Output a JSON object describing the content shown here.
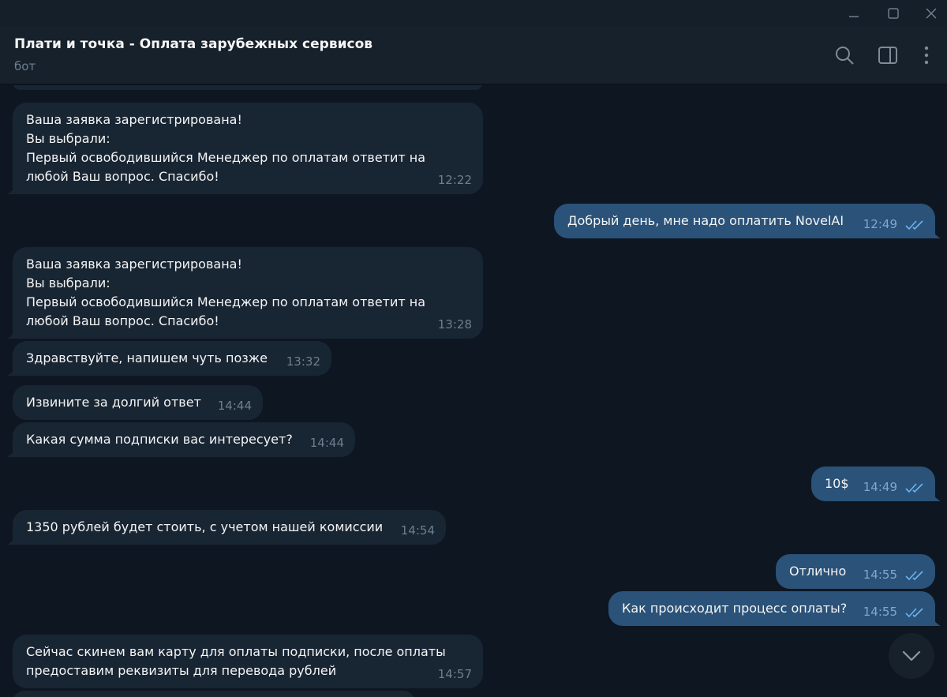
{
  "window": {
    "minimize_icon": "minimize-icon",
    "maximize_icon": "maximize-icon",
    "close_icon": "close-icon"
  },
  "header": {
    "title": "Плати и точка - Оплата зарубежных сервисов",
    "subtitle": "бот",
    "icons": [
      "search-icon",
      "sidebar-toggle-icon",
      "more-vertical-icon"
    ]
  },
  "messages": [
    {
      "dir": "in",
      "lines": [
        "Ваша заявка зарегистрирована!",
        "Вы выбрали:",
        "Первый освободившийся Менеджер по оплатам ответит на",
        "любой Ваш вопрос. Спасибо!"
      ],
      "time": "12:22"
    },
    {
      "dir": "out",
      "lines": [
        "Добрый день, мне надо оплатить NovelAI"
      ],
      "time": "12:49",
      "read": true
    },
    {
      "dir": "in",
      "lines": [
        "Ваша заявка зарегистрирована!",
        "Вы выбрали:",
        "Первый освободившийся Менеджер по оплатам ответит на",
        "любой Ваш вопрос. Спасибо!"
      ],
      "time": "13:28"
    },
    {
      "dir": "in",
      "lines": [
        "Здравствуйте, напишем чуть позже"
      ],
      "time": "13:32"
    },
    {
      "dir": "in",
      "lines": [
        "Извините за долгий ответ"
      ],
      "time": "14:44"
    },
    {
      "dir": "in",
      "lines": [
        "Какая сумма подписки вас интересует?"
      ],
      "time": "14:44"
    },
    {
      "dir": "out",
      "lines": [
        "10$"
      ],
      "time": "14:49",
      "read": true
    },
    {
      "dir": "in",
      "lines": [
        "1350 рублей будет стоить, с учетом нашей комиссии"
      ],
      "time": "14:54"
    },
    {
      "dir": "out",
      "lines": [
        "Отлично"
      ],
      "time": "14:55",
      "read": true
    },
    {
      "dir": "out",
      "lines": [
        "Как происходит процесс оплаты?"
      ],
      "time": "14:55",
      "read": true
    },
    {
      "dir": "in",
      "lines": [
        "Сейчас скинем вам карту для оплаты подписки, после оплаты",
        "предоставим реквизиты для перевода рублей"
      ],
      "time": "14:57"
    }
  ],
  "scroll_down_icon": "chevron-down-icon",
  "colors": {
    "background": "#0e1621",
    "header": "#17212b",
    "incoming": "#182533",
    "outgoing": "#2b5278",
    "muted": "#6d7f8f",
    "check": "#6ab3f3"
  }
}
